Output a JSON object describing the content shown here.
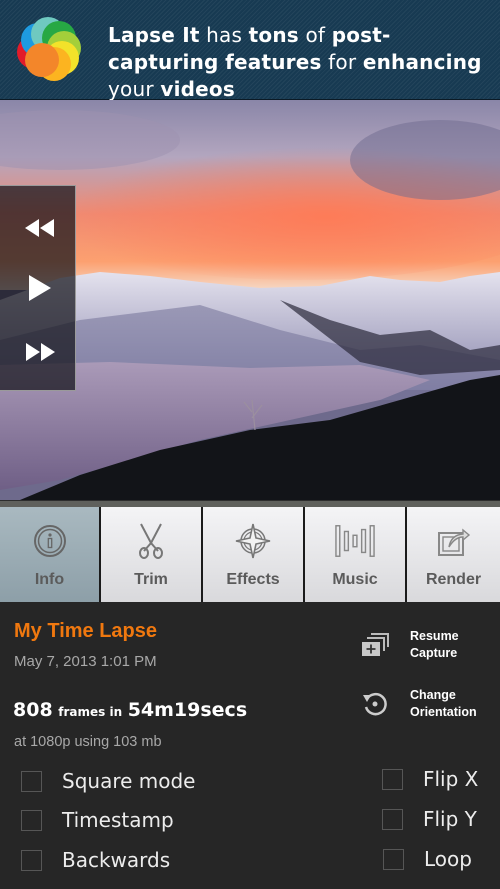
{
  "banner": {
    "segments": [
      {
        "text": "Lapse It",
        "bold": true
      },
      {
        "text": " has ",
        "bold": false
      },
      {
        "text": "tons",
        "bold": true
      },
      {
        "text": " of ",
        "bold": false
      },
      {
        "text": "post-capturing",
        "bold": true
      },
      {
        "text": " ",
        "bold": false
      },
      {
        "text": "features",
        "bold": true
      },
      {
        "text": " for ",
        "bold": false
      },
      {
        "text": "enhancing",
        "bold": true
      },
      {
        "text": " your ",
        "bold": false
      },
      {
        "text": "videos",
        "bold": true
      }
    ],
    "logo_icon": "lapse-it-logo"
  },
  "player": {
    "rewind_icon": "rewind-icon",
    "play_icon": "play-icon",
    "forward_icon": "fast-forward-icon"
  },
  "toolbar": {
    "items": [
      {
        "label": "Info",
        "icon": "info-icon",
        "active": true
      },
      {
        "label": "Trim",
        "icon": "scissors-icon",
        "active": false
      },
      {
        "label": "Effects",
        "icon": "effects-icon",
        "active": false
      },
      {
        "label": "Music",
        "icon": "music-icon",
        "active": false
      },
      {
        "label": "Render",
        "icon": "render-share-icon",
        "active": false
      }
    ]
  },
  "project": {
    "title": "My Time Lapse",
    "date": "May 7, 2013 1:01 PM",
    "frames_count": "808",
    "frames_word": "frames in",
    "duration": "54m19secs",
    "resolution_info": "at 1080p using 103 mb"
  },
  "actions": {
    "resume_capture": "Resume\nCapture",
    "resume_line1": "Resume",
    "resume_line2": "Capture",
    "change_line1": "Change",
    "change_line2": "Orientation"
  },
  "options": {
    "left": [
      {
        "label": "Square mode",
        "checked": false
      },
      {
        "label": "Timestamp",
        "checked": false
      },
      {
        "label": "Backwards",
        "checked": false
      }
    ],
    "right": [
      {
        "label": "Flip X",
        "checked": false
      },
      {
        "label": "Flip Y",
        "checked": false
      },
      {
        "label": "Loop",
        "checked": false
      }
    ]
  },
  "colors": {
    "accent": "#f0780f",
    "banner_bg": "#173a52",
    "panel_bg": "#262626",
    "active_tab": "#9aabb3"
  }
}
